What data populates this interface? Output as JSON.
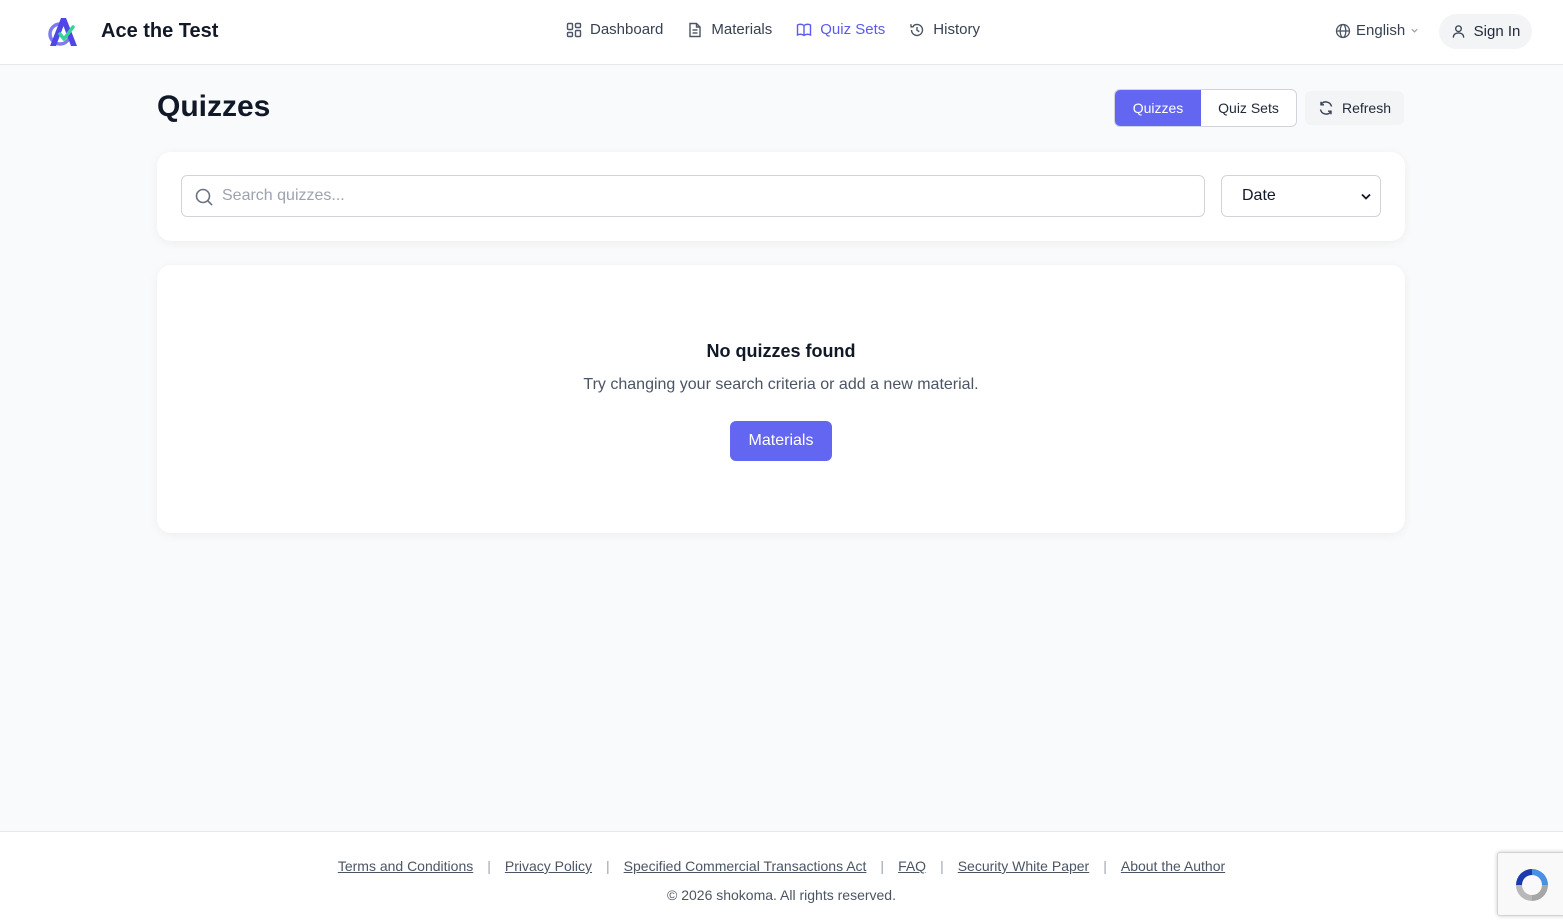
{
  "header": {
    "brand_name": "Ace the Test",
    "nav": [
      {
        "label": "Dashboard",
        "icon": "dashboard-grid-icon"
      },
      {
        "label": "Materials",
        "icon": "document-icon"
      },
      {
        "label": "Quiz Sets",
        "icon": "book-open-icon",
        "active": true
      },
      {
        "label": "History",
        "icon": "history-icon"
      }
    ],
    "language": "English",
    "sign_in": "Sign In"
  },
  "page": {
    "title": "Quizzes",
    "segments": [
      "Quizzes",
      "Quiz Sets"
    ],
    "active_segment": "Quizzes",
    "refresh": "Refresh"
  },
  "search": {
    "placeholder": "Search quizzes...",
    "value": "",
    "sort_value": "Date"
  },
  "empty_state": {
    "title": "No quizzes found",
    "description": "Try changing your search criteria or add a new material.",
    "button": "Materials"
  },
  "footer": {
    "links": [
      "Terms and Conditions",
      "Privacy Policy",
      "Specified Commercial Transactions Act",
      "FAQ",
      "Security White Paper",
      "About the Author"
    ],
    "copyright": "© 2026 shokoma. All rights reserved."
  },
  "colors": {
    "accent": "#6366f1",
    "background": "#f9fafb"
  }
}
